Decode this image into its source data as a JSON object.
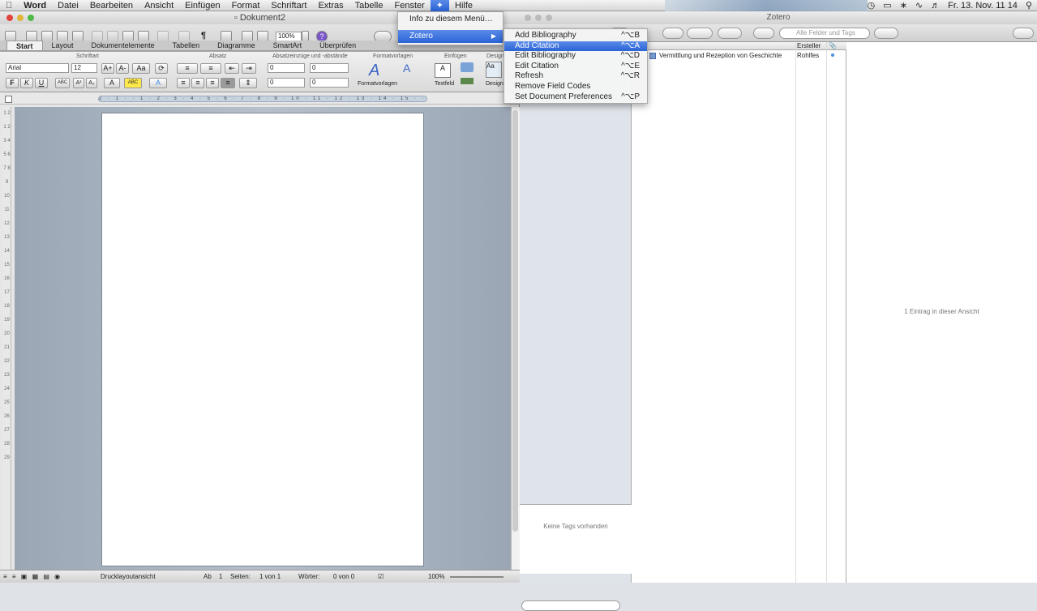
{
  "menubar": {
    "apple": "",
    "app": "Word",
    "items": [
      "Datei",
      "Bearbeiten",
      "Ansicht",
      "Einfügen",
      "Format",
      "Schriftart",
      "Extras",
      "Tabelle",
      "Fenster"
    ],
    "script_icon": "script-menu-icon",
    "help": "Hilfe",
    "datetime": "Fr. 13. Nov. 11 14"
  },
  "word": {
    "title": "Dokument2",
    "zoom": "100%",
    "tabs": [
      "Start",
      "Layout",
      "Dokumentelemente",
      "Tabellen",
      "Diagramme",
      "SmartArt",
      "Überprüfen"
    ],
    "selected_tab": "Start",
    "sections": {
      "schriftart": "Schriftart",
      "absatz": "Absatz",
      "abstaende": "Absatzeinzüge und -abstände",
      "formatvorlagen": "Formatvorlagen",
      "einfuegen": "Einfügen",
      "design": "Design"
    },
    "font_name": "Arial",
    "font_size": "12",
    "indent_left": "0",
    "indent_right": "0",
    "space_before": "0",
    "space_after": "0",
    "formatvorlagen_label": "Formatvorlagen",
    "textfeld_label": "Textfeld",
    "design_label": "Design",
    "ruler_marks": "2 · 1 · · 1 · 2 · 3 · 4 · 5 · 6 · 7 · 8 · 9 · 10 · 11 · 12 · 13 · 14 · 15 · · 17 · 18",
    "vruler_marks": "1 2 1 2 3 4 5 6 7 8 9 10 11 12 13 14 15 16 17 18 19 20 21 22 23 24 25 26 27 28 29",
    "status": {
      "view": "Drucklayoutansicht",
      "ab_label": "Ab",
      "ab_value": "1",
      "seiten_label": "Seiten:",
      "seiten_value": "1 von 1",
      "woerter_label": "Wörter:",
      "woerter_value": "0 von 0",
      "zoom": "100%"
    }
  },
  "zotero": {
    "title": "Zotero",
    "search_placeholder": "Alle Felder und Tags",
    "column_creator": "Ersteller",
    "item_title": "Vermittlung und Rezeption von Geschichte",
    "item_creator": "Rohlfes",
    "tags_empty": "Keine Tags vorhanden",
    "count": "1 Eintrag in dieser Ansicht"
  },
  "menu1": {
    "about": "Info zu diesem Menü…",
    "zotero": "Zotero"
  },
  "menu2": {
    "items": [
      {
        "label": "Add Bibliography",
        "shortcut": "^⌥B"
      },
      {
        "label": "Add Citation",
        "shortcut": "^⌥A"
      },
      {
        "label": "Edit Bibliography",
        "shortcut": "^⌥D"
      },
      {
        "label": "Edit Citation",
        "shortcut": "^⌥E"
      },
      {
        "label": "Refresh",
        "shortcut": "^⌥R"
      },
      {
        "label": "Remove Field Codes",
        "shortcut": ""
      },
      {
        "label": "Set Document Preferences",
        "shortcut": "^⌥P"
      }
    ],
    "active": "Add Citation"
  },
  "colors": {
    "highlight": "#2a63d6",
    "red": "#e0443e",
    "yellow": "#e2b43a",
    "green": "#4fb947"
  }
}
